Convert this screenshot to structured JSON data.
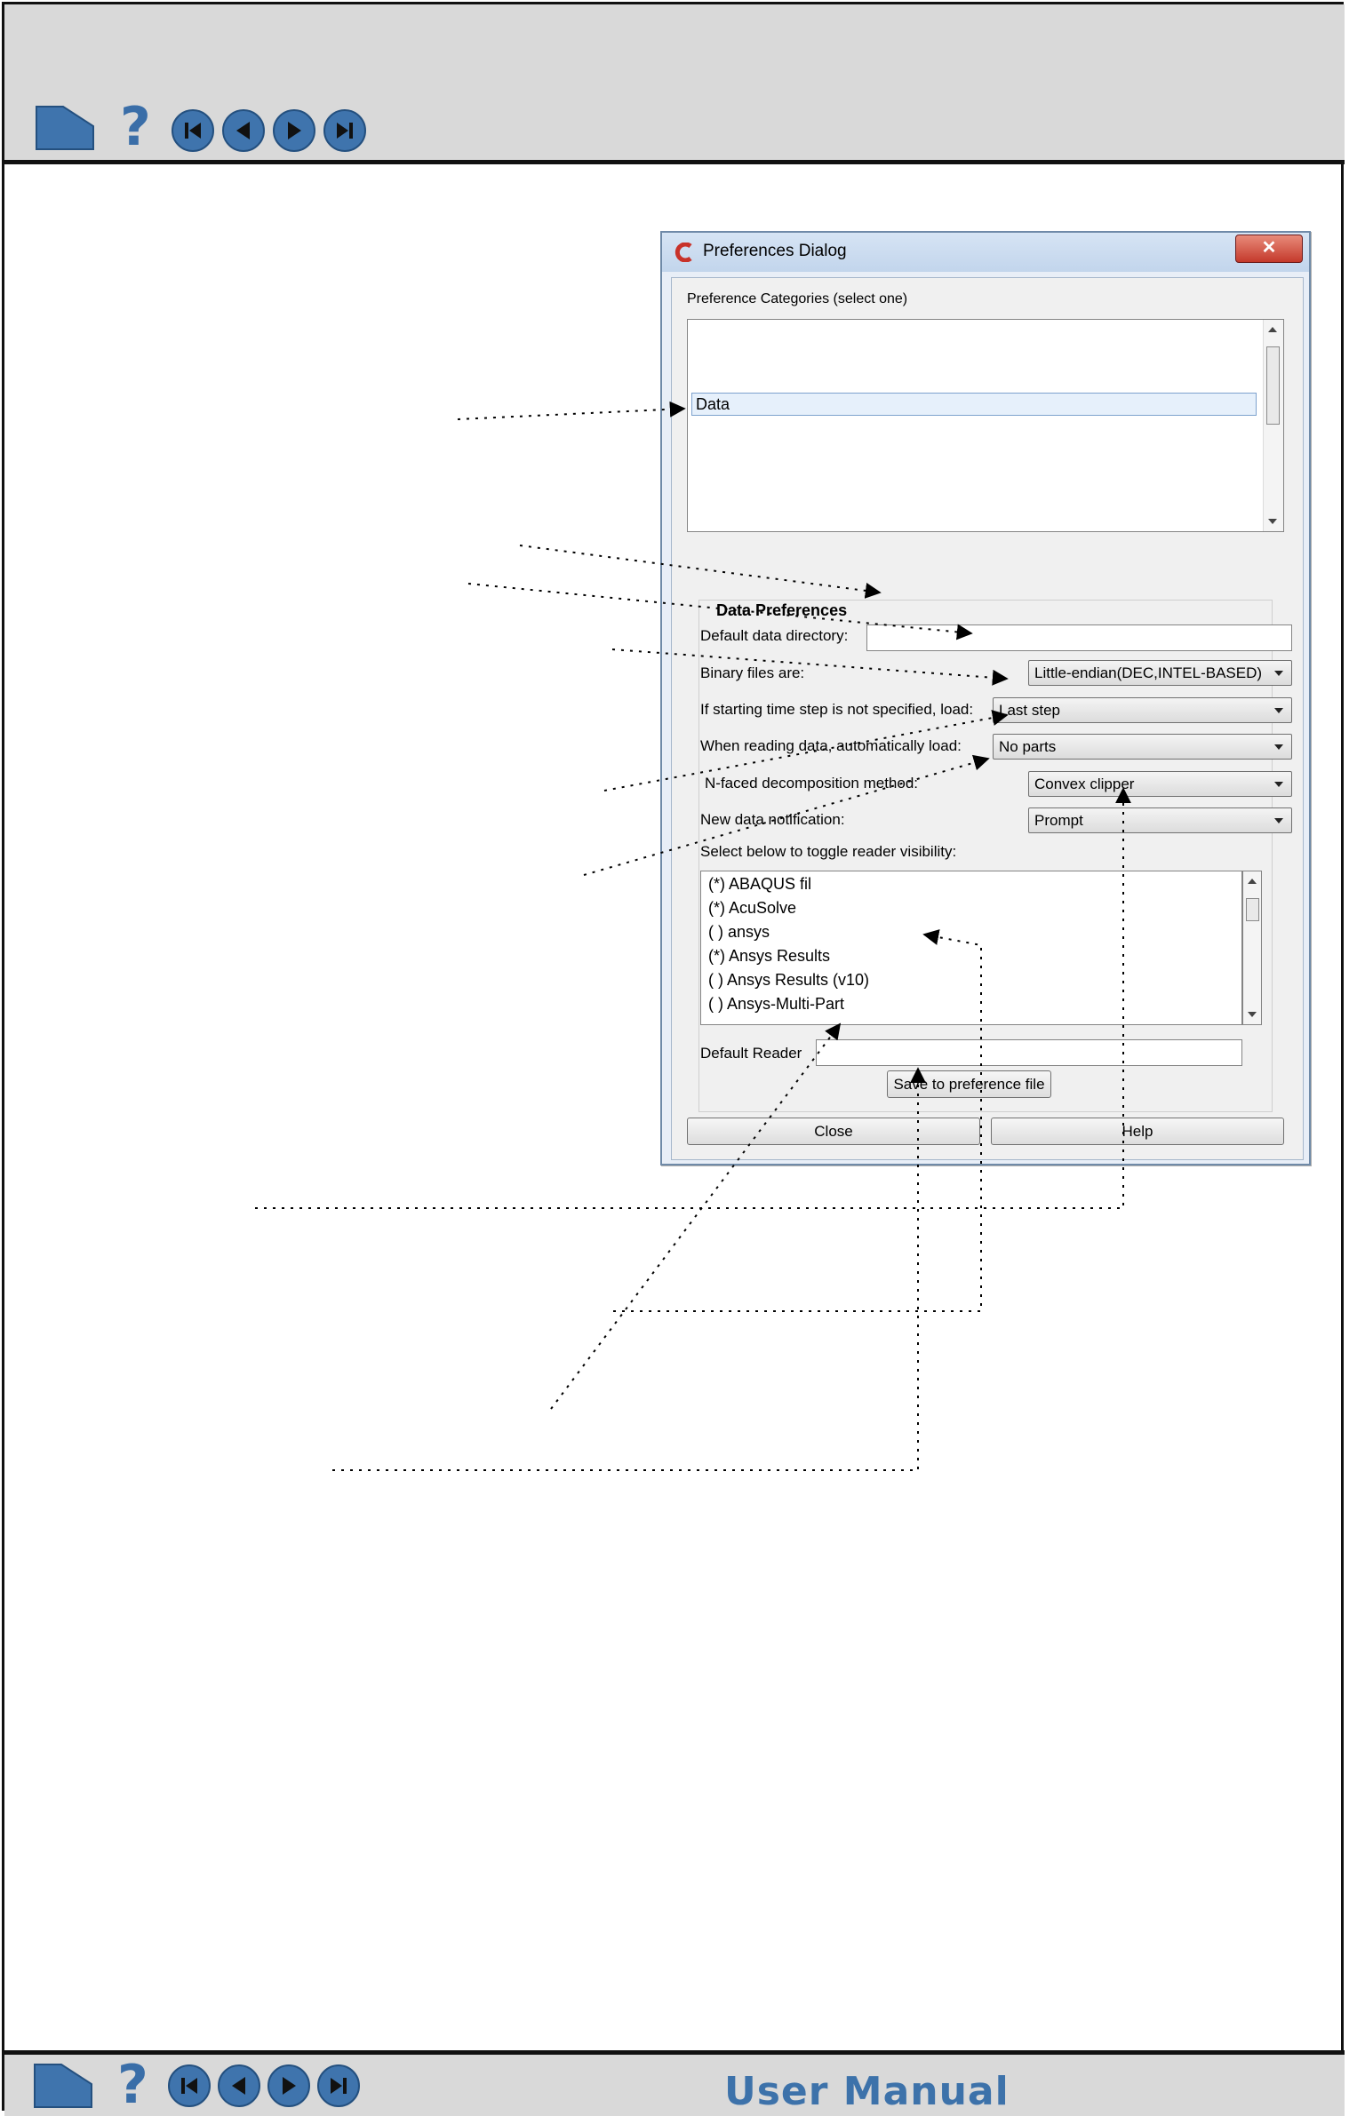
{
  "footer": {
    "title": "User Manual"
  },
  "dialog": {
    "title": "Preferences Dialog",
    "close_glyph": "✕",
    "categories": {
      "label": "Preference Categories (select one)",
      "items": [
        "Data"
      ]
    },
    "data_prefs": {
      "group_title": "Data Preferences",
      "default_dir_label": "Default data directory:",
      "default_dir_value": "",
      "binary_label": "Binary files are:",
      "binary_value": "Little-endian(DEC,INTEL-BASED)",
      "timestep_label": "If starting time step is not specified, load:",
      "timestep_value": "Last step",
      "autoload_label": "When reading data, automatically load:",
      "autoload_value": "No parts",
      "nfaced_label": "N-faced decomposition method:",
      "nfaced_value": "Convex clipper",
      "notify_label": "New data notification:",
      "notify_value": "Prompt",
      "readers_label": "Select below to toggle reader visibility:",
      "readers": [
        "(*) ABAQUS fil",
        "(*) AcuSolve",
        "( ) ansys",
        "(*) Ansys Results",
        "( ) Ansys Results (v10)",
        "( ) Ansys-Multi-Part"
      ],
      "default_reader_label": "Default Reader",
      "default_reader_value": "",
      "save_label": "Save to preference file"
    },
    "close_label": "Close",
    "help_label": "Help"
  },
  "icons": {
    "nav": [
      "home-icon",
      "help-icon",
      "first-page-icon",
      "previous-page-icon",
      "next-page-icon",
      "last-page-icon"
    ]
  }
}
